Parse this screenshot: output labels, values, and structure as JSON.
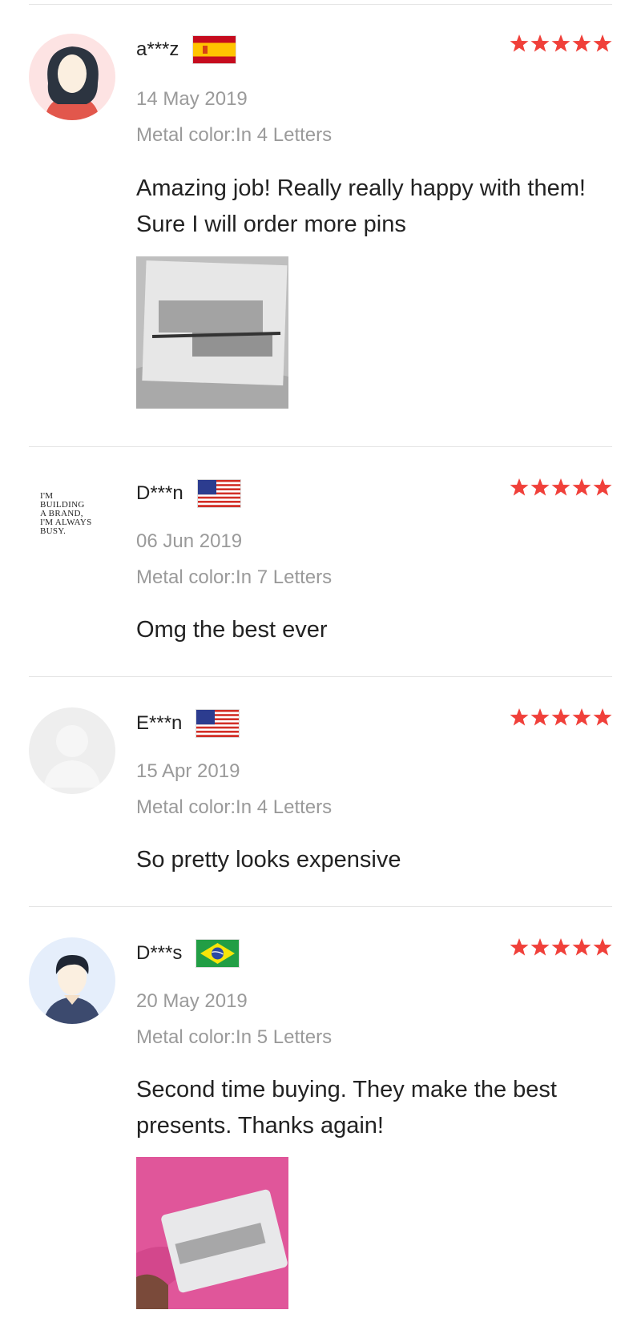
{
  "reviews": [
    {
      "name": "a***z",
      "flag": "spain-flag",
      "rating": 5,
      "date": "14 May 2019",
      "meta": "Metal color:In 4 Letters",
      "text": "Amazing job! Really really happy with them! Sure I will order more pins",
      "avatar": "woman-avatar-icon",
      "has_photo": true
    },
    {
      "name": "D***n",
      "flag": "usa-flag",
      "rating": 5,
      "date": "06 Jun 2019",
      "meta": "Metal color:In 7 Letters",
      "text": "Omg the best ever",
      "avatar_text": [
        "I'M",
        "BUILDING",
        "A BRAND,",
        "I'M ALWAYS",
        "BUSY."
      ],
      "has_photo": false
    },
    {
      "name": "E***n",
      "flag": "usa-flag",
      "rating": 5,
      "date": "15 Apr 2019",
      "meta": "Metal color:In 4 Letters",
      "text": "So pretty looks expensive",
      "avatar": "default-avatar-icon",
      "has_photo": false
    },
    {
      "name": "D***s",
      "flag": "brazil-flag",
      "rating": 5,
      "date": "20 May 2019",
      "meta": "Metal color:In 5 Letters",
      "text": "Second time buying. They make the best presents. Thanks again!",
      "avatar": "man-avatar-icon",
      "has_photo": true
    }
  ],
  "colors": {
    "star": "#f0403a",
    "muted_text": "#9a9a9a",
    "divider": "#e5e5e5"
  }
}
